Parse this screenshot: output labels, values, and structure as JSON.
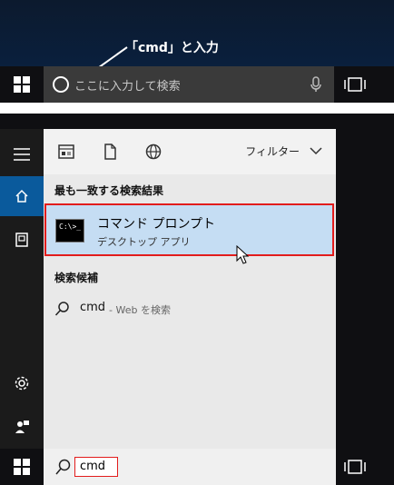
{
  "annotation": {
    "text": "「cmd」と入力"
  },
  "top_taskbar": {
    "search_placeholder": "ここに入力して検索"
  },
  "search_panel": {
    "filter_label": "フィルター",
    "best_match_heading": "最も一致する検索結果",
    "best_match": {
      "title": "コマンド プロンプト",
      "subtitle": "デスクトップ アプリ",
      "icon_text": "C:\\>_"
    },
    "suggestions_heading": "検索候補",
    "suggestion": {
      "term": "cmd",
      "description": "- Web を検索"
    }
  },
  "bottom_taskbar": {
    "search_value": "cmd"
  },
  "colors": {
    "highlight": "#c5ddf3",
    "annotation_border": "#e21c1c",
    "rail_selected": "#0a5a9c"
  }
}
